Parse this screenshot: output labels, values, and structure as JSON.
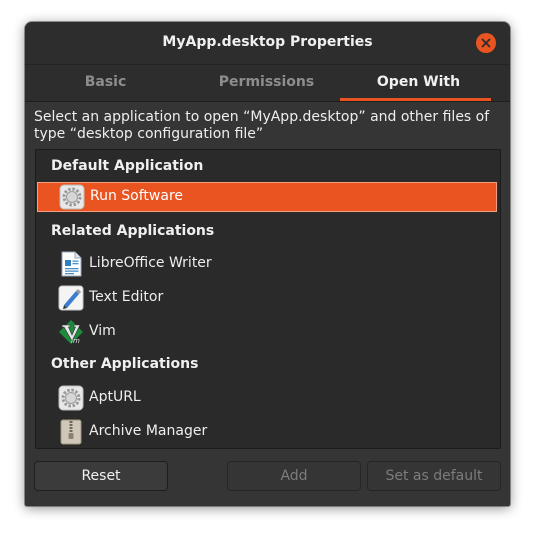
{
  "window": {
    "title": "MyApp.desktop Properties"
  },
  "tabs": [
    {
      "label": "Basic",
      "active": false
    },
    {
      "label": "Permissions",
      "active": false
    },
    {
      "label": "Open With",
      "active": true
    }
  ],
  "description": "Select an application to open “MyApp.desktop” and other files of type “desktop configuration file”",
  "sections": {
    "default": {
      "heading": "Default Application",
      "apps": [
        {
          "label": "Run Software",
          "icon": "gear-icon",
          "selected": true
        }
      ]
    },
    "related": {
      "heading": "Related Applications",
      "apps": [
        {
          "label": "LibreOffice Writer",
          "icon": "writer-document-icon"
        },
        {
          "label": "Text Editor",
          "icon": "pencil-icon"
        },
        {
          "label": "Vim",
          "icon": "vim-icon"
        }
      ]
    },
    "other": {
      "heading": "Other Applications",
      "apps": [
        {
          "label": "AptURL",
          "icon": "gear-icon"
        },
        {
          "label": "Archive Manager",
          "icon": "archive-icon"
        }
      ]
    }
  },
  "buttons": {
    "reset": {
      "label": "Reset",
      "enabled": true
    },
    "add": {
      "label": "Add",
      "enabled": false
    },
    "set_default": {
      "label": "Set as default",
      "enabled": false
    }
  },
  "colors": {
    "accent": "#e95420",
    "window_bg": "#353535",
    "list_bg": "#2a2a2a"
  }
}
